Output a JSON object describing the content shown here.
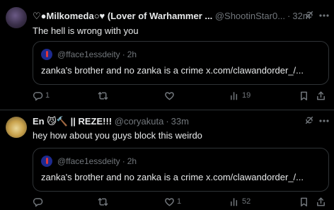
{
  "posts": [
    {
      "display_name": "♡●Milkomeda○♥ (Lover of Warhammer ...",
      "handle": "@ShootinStar0...",
      "time": "32m",
      "text": "The hell is wrong with you",
      "quote": {
        "handle": "@fface1essdeity",
        "time": "2h",
        "text": "zanka's brother and no zanka is a crime x.com/clawandorder_/..."
      },
      "stats": {
        "replies": "1",
        "reposts": "",
        "likes": "",
        "views": "19"
      }
    },
    {
      "display_name": "En 😼🔨 || REZE!!!",
      "handle": "@coryakuta",
      "time": "33m",
      "text": "hey how about you guys block this weirdo",
      "quote": {
        "handle": "@fface1essdeity",
        "time": "2h",
        "text": "zanka's brother and no zanka is a crime x.com/clawandorder_/..."
      },
      "stats": {
        "replies": "",
        "reposts": "",
        "likes": "1",
        "views": "52"
      }
    }
  ],
  "dot": "·",
  "colors": {
    "background": "#000000",
    "text": "#e7e9ea",
    "muted": "#71767b",
    "border": "#2f3336"
  },
  "icons": [
    "grok-icon",
    "more-icon",
    "reply-icon",
    "repost-icon",
    "like-icon",
    "views-icon",
    "bookmark-icon",
    "share-icon"
  ]
}
